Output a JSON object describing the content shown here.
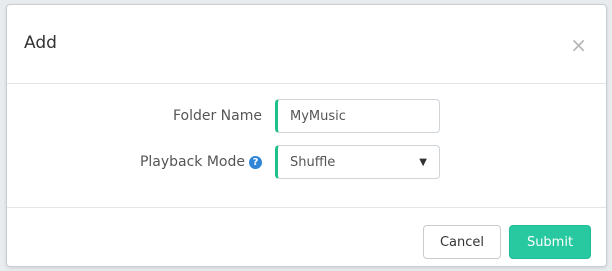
{
  "dialog": {
    "title": "Add",
    "close_glyph": "×",
    "close_icon": "close-icon"
  },
  "form": {
    "folder_name_label": "Folder Name",
    "folder_name_value": "MyMusic",
    "playback_mode_label": "Playback Mode",
    "help_icon": "question-circle-icon",
    "help_glyph": "?",
    "playback_mode_value": "Shuffle",
    "dropdown_glyph": "▼"
  },
  "footer": {
    "cancel_label": "Cancel",
    "submit_label": "Submit"
  },
  "colors": {
    "accent": "#28c8a0",
    "field_accent": "#1fc08a",
    "help_icon": "#2f86d6"
  }
}
